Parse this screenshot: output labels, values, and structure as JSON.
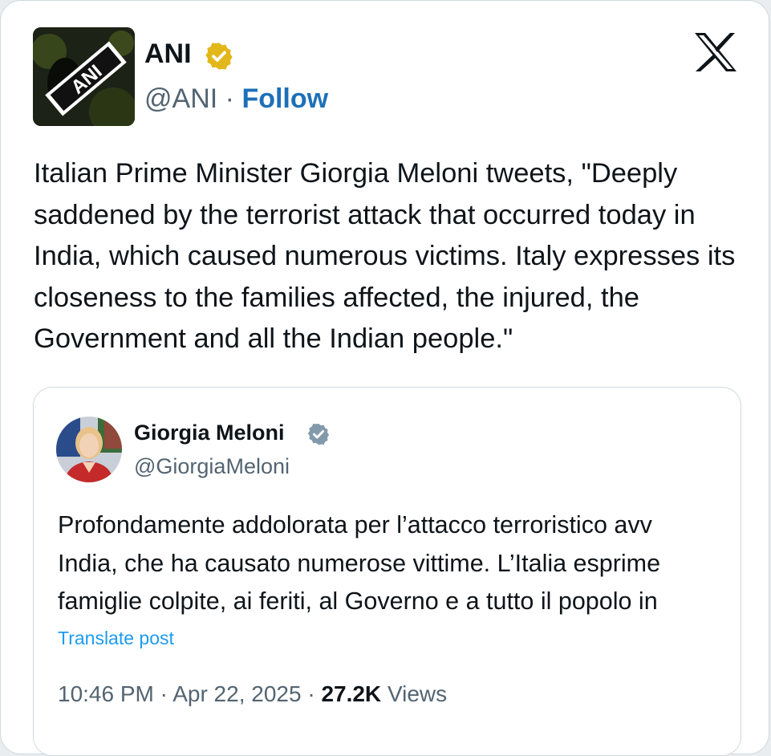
{
  "post": {
    "author_name": "ANI",
    "author_handle": "@ANI",
    "separator": "·",
    "follow_label": "Follow",
    "avatar_text": "ANI",
    "text": "Italian Prime Minister Giorgia Meloni tweets, \"Deeply saddened by the terrorist attack that occurred today in India, which caused numerous victims. Italy expresses its closeness to the families affected, the injured, the Government and all the Indian people.\""
  },
  "quoted_post": {
    "author_name": "Giorgia Meloni",
    "author_handle": "@GiorgiaMeloni",
    "text_lines": [
      "Profondamente addolorata per l’attacco terroristico avv",
      "India, che ha causato numerose vittime. L’Italia esprime",
      "famiglie colpite, ai feriti, al Governo e a tutto il popolo in"
    ],
    "translate_label": "Translate post",
    "time": "10:46 PM",
    "date": "Apr 22, 2025",
    "separator": "·",
    "views_count": "27.2K",
    "views_label": "Views"
  },
  "icons": {
    "verified_ani": "verified-badge-gold-icon",
    "verified_meloni": "verified-badge-gray-icon",
    "x_logo": "x-logo-icon"
  },
  "colors": {
    "follow": "#1d70b8",
    "translate": "#1d9bf0",
    "secondary_text": "#536471",
    "gold_badge": "#e2b719",
    "gray_badge": "#829aab"
  }
}
